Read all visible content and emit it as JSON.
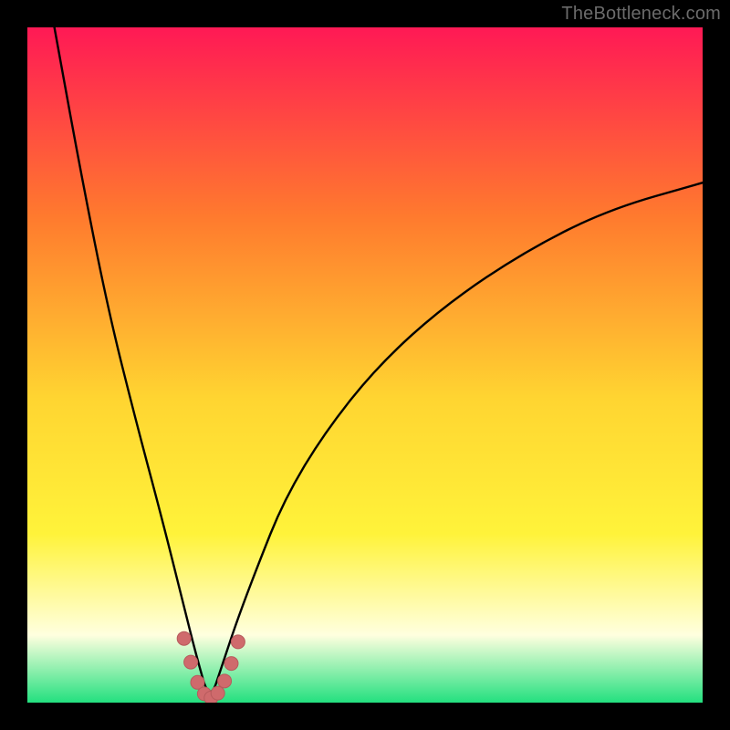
{
  "watermark": "TheBottleneck.com",
  "colors": {
    "frame": "#000000",
    "curve": "#000000",
    "markers": "#cf6a6c",
    "markers_stroke": "#b75a5c",
    "gradient_top": "#ff1955",
    "gradient_mid_upper": "#ff7a2e",
    "gradient_mid": "#ffd531",
    "gradient_mid_lower": "#fff33a",
    "gradient_pale": "#ffffdf",
    "gradient_base": "#23e07f"
  },
  "chart_data": {
    "type": "line",
    "title": "",
    "xlabel": "",
    "ylabel": "",
    "xlim": [
      0,
      100
    ],
    "ylim": [
      0,
      100
    ],
    "notes": "Bottleneck-style V-curve; minimum (zero bottleneck) near x≈27. Left branch rises steeply to ~100 at x≈4; right branch rises more gradually to ~77 at x≈100. Salmon markers cluster around the trough.",
    "series": [
      {
        "name": "bottleneck-curve",
        "x": [
          4,
          8,
          12,
          16,
          20,
          23,
          25,
          27,
          29,
          31,
          34,
          38,
          44,
          52,
          62,
          74,
          86,
          100
        ],
        "values": [
          100,
          78,
          58,
          42,
          27,
          15,
          7,
          0,
          6,
          12,
          20,
          30,
          40,
          50,
          59,
          67,
          73,
          77
        ]
      },
      {
        "name": "trough-markers",
        "x": [
          23.2,
          24.2,
          25.2,
          26.2,
          27.2,
          28.2,
          29.2,
          30.2,
          31.2
        ],
        "values": [
          9.5,
          6.0,
          3.0,
          1.3,
          0.7,
          1.4,
          3.2,
          5.8,
          9.0
        ]
      }
    ]
  }
}
